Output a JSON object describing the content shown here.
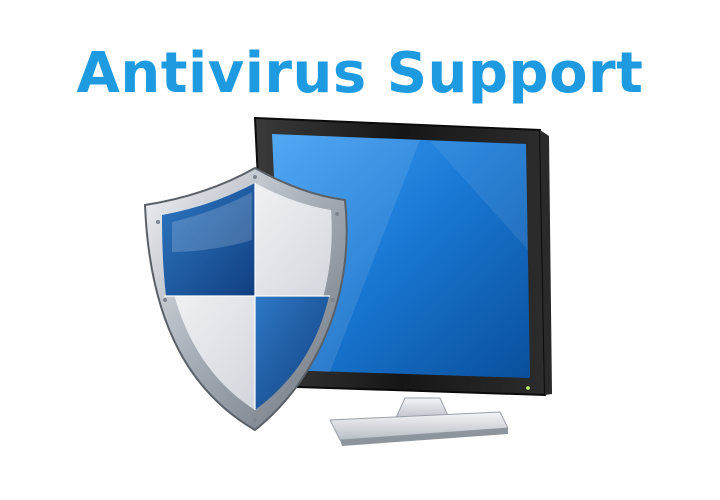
{
  "title": "Antivirus Support",
  "colors": {
    "title": "#1e9be0",
    "screen_blue": "#1170c8",
    "bezel": "#1a1a1a",
    "shield_blue": "#1f5fa8",
    "shield_silver": "#dfe3e8"
  },
  "icons": {
    "monitor": "monitor-icon",
    "shield": "shield-icon"
  }
}
